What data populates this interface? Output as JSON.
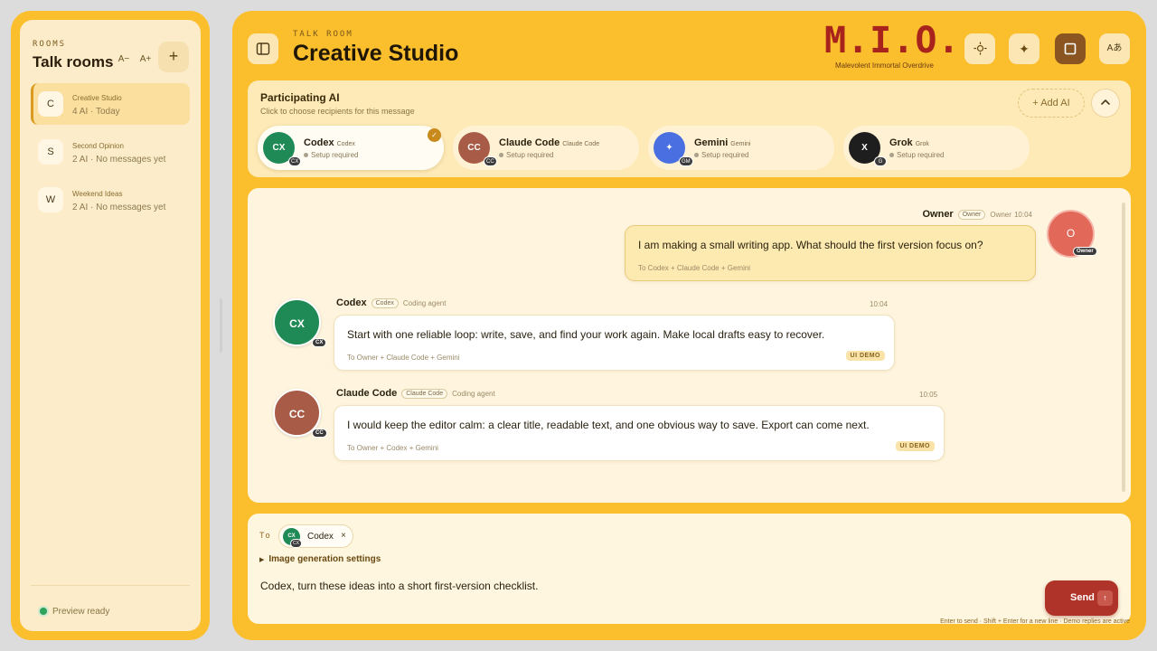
{
  "sidebar": {
    "kicker": "ROOMS",
    "title": "Talk rooms",
    "font_decrease": "A−",
    "font_increase": "A+",
    "add_room": "+",
    "rooms": [
      {
        "initial": "C",
        "name": "Creative Studio",
        "meta": "4 AI · Today",
        "active": true
      },
      {
        "initial": "S",
        "name": "Second Opinion",
        "meta": "2 AI · No messages yet",
        "active": false
      },
      {
        "initial": "W",
        "name": "Weekend Ideas",
        "meta": "2 AI · No messages yet",
        "active": false
      }
    ],
    "status": "Preview ready"
  },
  "header": {
    "kicker": "TALK ROOM",
    "title": "Creative Studio",
    "brand": "M.I.O.",
    "tagline": "Malevolent Immortal Overdrive",
    "lang_button": "Aあ"
  },
  "participants": {
    "title": "Participating AI",
    "subtitle": "Click to choose recipients for this message",
    "add_label": "+ Add AI",
    "agents": [
      {
        "abbr": "CX",
        "name": "Codex",
        "tag": "Codex",
        "status": "Setup required",
        "color": "#1f8a55",
        "badge": "CX",
        "selected": true
      },
      {
        "abbr": "CC",
        "name": "Claude Code",
        "tag": "Claude Code",
        "status": "Setup required",
        "color": "#a85c48",
        "badge": "CC",
        "selected": false
      },
      {
        "abbr": "✦",
        "name": "Gemini",
        "tag": "Gemini",
        "status": "Setup required",
        "color": "#4a6fe0",
        "badge": "GM",
        "selected": false
      },
      {
        "abbr": "X",
        "name": "Grok",
        "tag": "Grok",
        "status": "Setup required",
        "color": "#1e1e1e",
        "badge": "G",
        "selected": false
      }
    ]
  },
  "chat": {
    "owner": {
      "name": "Owner",
      "tag": "Owner",
      "role": "Owner",
      "time": "10:04",
      "avatar": "O",
      "badge": "Owner",
      "text": "I am making a small writing app. What should the first version focus on?",
      "to": "To Codex + Claude Code + Gemini"
    },
    "replies": [
      {
        "name": "Codex",
        "tag": "Codex",
        "role": "Coding agent",
        "time": "10:04",
        "avatar": "CX",
        "badge": "CX",
        "color": "#1f8a55",
        "text": "Start with one reliable loop: write, save, and find your work again. Make local drafts easy to recover.",
        "to": "To Owner + Claude Code + Gemini",
        "demo": "UI DEMO"
      },
      {
        "name": "Claude Code",
        "tag": "Claude Code",
        "role": "Coding agent",
        "time": "10:05",
        "avatar": "CC",
        "badge": "CC",
        "color": "#a85c48",
        "text": "I would keep the editor calm: a clear title, readable text, and one obvious way to save. Export can come next.",
        "to": "To Owner + Codex + Gemini",
        "demo": "UI DEMO"
      }
    ]
  },
  "composer": {
    "to_label": "To",
    "recipient": {
      "abbr": "CX",
      "badge": "CX",
      "name": "Codex",
      "remove": "×"
    },
    "image_settings": "Image generation settings",
    "message": "Codex, turn these ideas into a short first-version checklist.",
    "send_label": "Send",
    "hint": "Enter to send · Shift + Enter for a new line · Demo replies are active"
  }
}
